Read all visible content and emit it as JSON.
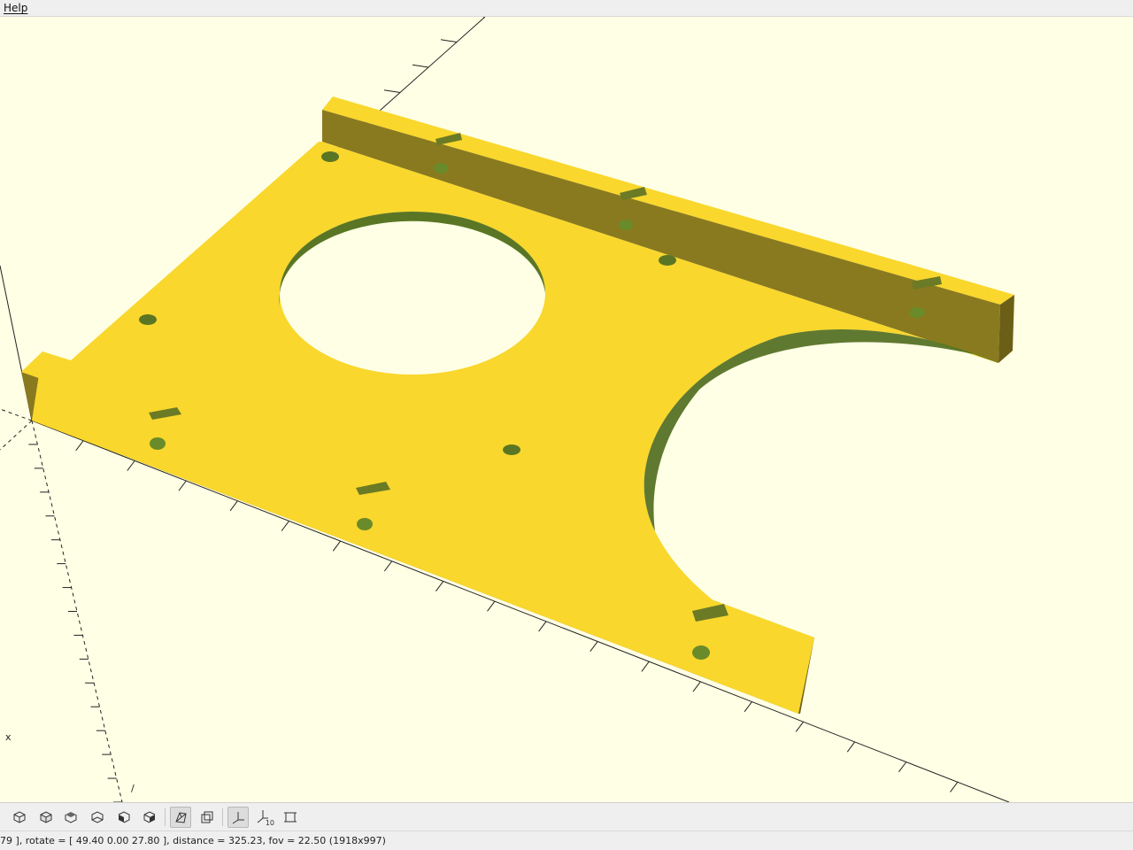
{
  "app": {
    "menu": {
      "help_label": "Help"
    }
  },
  "viewport": {
    "background_color": "#ffffe5",
    "model_color": "#f9d72c",
    "model_shadow_color": "#8a7820",
    "hole_color": "#5f7a27",
    "axis_label_x": "x",
    "axis_label_z": "/"
  },
  "toolbar": {
    "buttons": [
      {
        "icon": "preview-icon",
        "active": false
      },
      {
        "icon": "render-icon",
        "active": false
      },
      {
        "icon": "view-top-icon",
        "active": false
      },
      {
        "icon": "view-bottom-icon",
        "active": false
      },
      {
        "icon": "view-left-icon",
        "active": false
      },
      {
        "icon": "view-right-icon",
        "active": false
      },
      {
        "icon": "perspective-icon",
        "active": true
      },
      {
        "icon": "orthogonal-icon",
        "active": false
      },
      {
        "icon": "show-axes-icon",
        "active": true
      },
      {
        "icon": "show-scale-markers-icon",
        "active": false
      },
      {
        "icon": "show-edges-icon",
        "active": false
      }
    ],
    "scale_marker_label": "10"
  },
  "status": {
    "text": "79 ], rotate = [ 49.40 0.00 27.80 ], distance = 325.23, fov = 22.50 (1918x997)"
  }
}
